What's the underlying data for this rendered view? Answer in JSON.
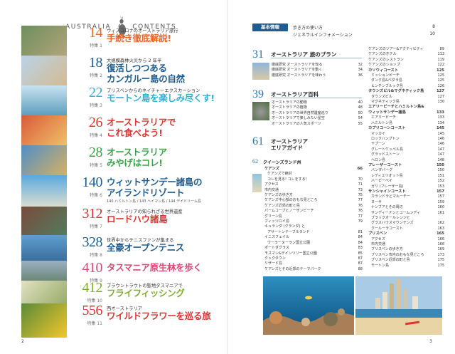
{
  "header": {
    "left_word": "AUSTRALIA",
    "right_word": "CONTENTS"
  },
  "features": [
    {
      "num": "14",
      "tokushu": "特集 1",
      "color": "#e96a2a",
      "sub": "ウィズコロナのオーストラリア旅行",
      "title": [
        "手続き徹底解説!"
      ],
      "note": ""
    },
    {
      "num": "18",
      "tokushu": "特集 2",
      "color": "#1e5c92",
      "sub": "大規模森林火災から 2 年半",
      "title": [
        "復活しつつある",
        "カンガルー島の自然"
      ],
      "note": ""
    },
    {
      "num": "22",
      "tokushu": "特集 3",
      "color": "#2bb3d6",
      "sub": "ブリスベンからのネイチャーエクスカーション",
      "title": [
        "モートン島を楽しみ尽くす!"
      ],
      "note": ""
    },
    {
      "num": "26",
      "tokushu": "特集 4",
      "color": "#e0342f",
      "sub": "",
      "title": [
        "オーストラリアで",
        "これ食べよう!"
      ],
      "note": ""
    },
    {
      "num": "28",
      "tokushu": "特集 5",
      "color": "#3aa548",
      "sub": "",
      "title": [
        "オーストラリア",
        "みやげはコレ!"
      ],
      "note": ""
    },
    {
      "num": "140",
      "tokushu": "特集 6",
      "color": "#1e5c92",
      "sub": "",
      "title": [
        "ウィットサンデー諸島の",
        "アイランドリゾート"
      ],
      "note": "140 ハミルトン島 / 143 ヘイマン島 / 144 デイドリーム島"
    },
    {
      "num": "312",
      "tokushu": "特集 7",
      "color": "#e0342f",
      "sub": "オーストラリアの知られざる世界遺産",
      "title": [
        "ロードハウ諸島"
      ],
      "note": ""
    },
    {
      "num": "328",
      "tokushu": "特集 8",
      "color": "#1e5c92",
      "sub": "世界中からテニスファンが集まる",
      "title": [
        "全豪オープンテニス"
      ],
      "note": ""
    },
    {
      "num": "410",
      "tokushu": "特集 9",
      "color": "#d94a74",
      "sub": "",
      "title": [
        "タスマニア原生林を歩く"
      ],
      "note": ""
    },
    {
      "num": "412",
      "tokushu": "特集 10",
      "color": "#7fae2c",
      "sub": "ブラウントラウトの聖地タスマニアで",
      "title": [
        "フライフィッシング"
      ],
      "note": ""
    },
    {
      "num": "556",
      "tokushu": "特集 11",
      "color": "#e0342f",
      "sub": "西オーストラリア",
      "title": [
        "ワイルドフラワーを巡る旅"
      ],
      "note": ""
    }
  ],
  "kihon": {
    "label": "基本情報",
    "lines": [
      {
        "text": "歩き方の使い方",
        "page": "8"
      },
      {
        "text": "ジェネラルインフォメーション",
        "page": "10"
      }
    ]
  },
  "sections": [
    {
      "num": "31",
      "title": "オーストラリア 旅のプラン",
      "items": [
        {
          "t": "徹底研究 オーストラリアを知る",
          "p": "32"
        },
        {
          "t": "徹底研究 オーストラリアを動く",
          "p": "34"
        },
        {
          "t": "徹底研究 オーストラリアを味わう",
          "p": "36"
        }
      ]
    },
    {
      "num": "39",
      "title": "オーストラリア百科",
      "items": [
        {
          "t": "オーストラリアの動物",
          "p": "40"
        },
        {
          "t": "オーストラリアの植物",
          "p": "48"
        },
        {
          "t": "オーストラリアの世界自然遺産巡り",
          "p": "50"
        },
        {
          "t": "オーストラリアで楽しみたい星空",
          "p": "54"
        },
        {
          "t": "オーストラリアの人気スポーツ",
          "p": "55"
        }
      ]
    },
    {
      "num": "61",
      "title": "オーストラリア",
      "title2": "エリアガイド",
      "items": []
    }
  ],
  "qld": {
    "num": "62",
    "title": "クイーンズランド州",
    "items": [
      {
        "t": "ケアンズ",
        "p": "66",
        "h": true
      },
      {
        "t": "ケアンズで絶対",
        "p": "",
        "in": true
      },
      {
        "t": "コレを見る! コレをする!",
        "p": "70",
        "in": true
      },
      {
        "t": "アクセス",
        "p": "71"
      },
      {
        "t": "市内交通",
        "p": "73"
      },
      {
        "t": "ケアンズの歩き方",
        "p": "75"
      },
      {
        "t": "ケアンズ中心部のおもな見どころ",
        "p": "77"
      },
      {
        "t": "ケアンズ近郊の町と島",
        "p": "76"
      },
      {
        "t": "パームコーブとノーザンビーチ",
        "p": "76"
      },
      {
        "t": "グリーン島",
        "p": "77"
      },
      {
        "t": "フィッツロイ島",
        "p": "79"
      },
      {
        "t": "キュランダ (クランダ) と",
        "p": ""
      },
      {
        "t": "アサートンテーブルランド",
        "p": "81",
        "in": true
      },
      {
        "t": "イニスフェイル",
        "p": "84"
      },
      {
        "t": "ウーラーヌーラン国立公園",
        "p": "84",
        "in": true
      },
      {
        "t": "ポートダグラス",
        "p": "83"
      },
      {
        "t": "モスマン&デインツリー国立公園",
        "p": "85"
      },
      {
        "t": "クックタウン",
        "p": "87"
      },
      {
        "t": "リザード島",
        "p": "87"
      },
      {
        "t": "ケアンズとその近郊のテーマパーク",
        "p": "88"
      }
    ]
  },
  "col2": [
    {
      "t": "ケアンズのツアー&アクティビティ",
      "p": "89"
    },
    {
      "t": "ケアンズのホテル",
      "p": "113"
    },
    {
      "t": "ケアンズのレストラン",
      "p": "119"
    },
    {
      "t": "ケアンズのショップ",
      "p": "122"
    },
    {
      "t": "カソウィコースト",
      "p": "125",
      "h": true
    },
    {
      "t": "ミッションビーチ",
      "p": "125",
      "in": true
    },
    {
      "t": "ダンク島&ベダラ島",
      "p": "125",
      "in": true
    },
    {
      "t": "ヒンチンブルック島",
      "p": "126",
      "in": true
    },
    {
      "t": "タウンズビル&マグネティック島",
      "p": "127",
      "h": true
    },
    {
      "t": "タウンズビル",
      "p": "127",
      "in": true
    },
    {
      "t": "マグネティック島",
      "p": "130",
      "in": true
    },
    {
      "t": "エアリービーチとハミルトン島&",
      "p": "",
      "h": true
    },
    {
      "t": "ウィットサンデー諸島",
      "p": "133",
      "h": true
    },
    {
      "t": "エアリービーチ",
      "p": "133",
      "in": true
    },
    {
      "t": "ハミルトン島",
      "p": "134",
      "in": true
    },
    {
      "t": "カプリコーンコースト",
      "p": "145",
      "h": true
    },
    {
      "t": "マッカイ",
      "p": "145",
      "in": true
    },
    {
      "t": "ロックハンプトン",
      "p": "146",
      "in": true
    },
    {
      "t": "ヤプーン",
      "p": "146",
      "in": true
    },
    {
      "t": "グレートケッペル島",
      "p": "147",
      "in": true
    },
    {
      "t": "グラッドストーン",
      "p": "147",
      "in": true
    },
    {
      "t": "ヘロン島",
      "p": "148",
      "in": true
    },
    {
      "t": "フレーザーコースト",
      "p": "150",
      "h": true
    },
    {
      "t": "バンダバーグ",
      "p": "150",
      "in": true
    },
    {
      "t": "レディエリオット島",
      "p": "151",
      "in": true
    },
    {
      "t": "ハービーベイ",
      "p": "152",
      "in": true
    },
    {
      "t": "ガリ (フレーザー島)",
      "p": "153",
      "in": true
    },
    {
      "t": "サンシャインコースト",
      "p": "157",
      "h": true
    },
    {
      "t": "カランドラとマルーチー",
      "p": "157",
      "in": true
    },
    {
      "t": "ヌーサ",
      "p": "159",
      "in": true
    },
    {
      "t": "ナンブアとその周辺",
      "p": "160",
      "in": true
    },
    {
      "t": "サンディーナンとユームンディ",
      "p": "161",
      "in": true
    },
    {
      "t": "ブラックオールレンジと",
      "p": "",
      "in": true
    },
    {
      "t": "グラスハウスマウンテンズ",
      "p": "162",
      "in": true
    },
    {
      "t": "クールーラコースト",
      "p": "163",
      "in": true
    },
    {
      "t": "ブリスベン",
      "p": "165",
      "h": true
    },
    {
      "t": "アクセス",
      "p": "166",
      "in": true
    },
    {
      "t": "市内交通",
      "p": "166",
      "in": true
    },
    {
      "t": "ブリスベンの歩き方",
      "p": "169",
      "in": true
    },
    {
      "t": "ブリスベン市内のおもな見どころ",
      "p": "173",
      "in": true
    },
    {
      "t": "ブリスベン近郊の町と島",
      "p": "175",
      "in": true
    },
    {
      "t": "モートン島",
      "p": "175",
      "in": true
    }
  ],
  "page_numbers": {
    "left": "2",
    "right": "3"
  }
}
